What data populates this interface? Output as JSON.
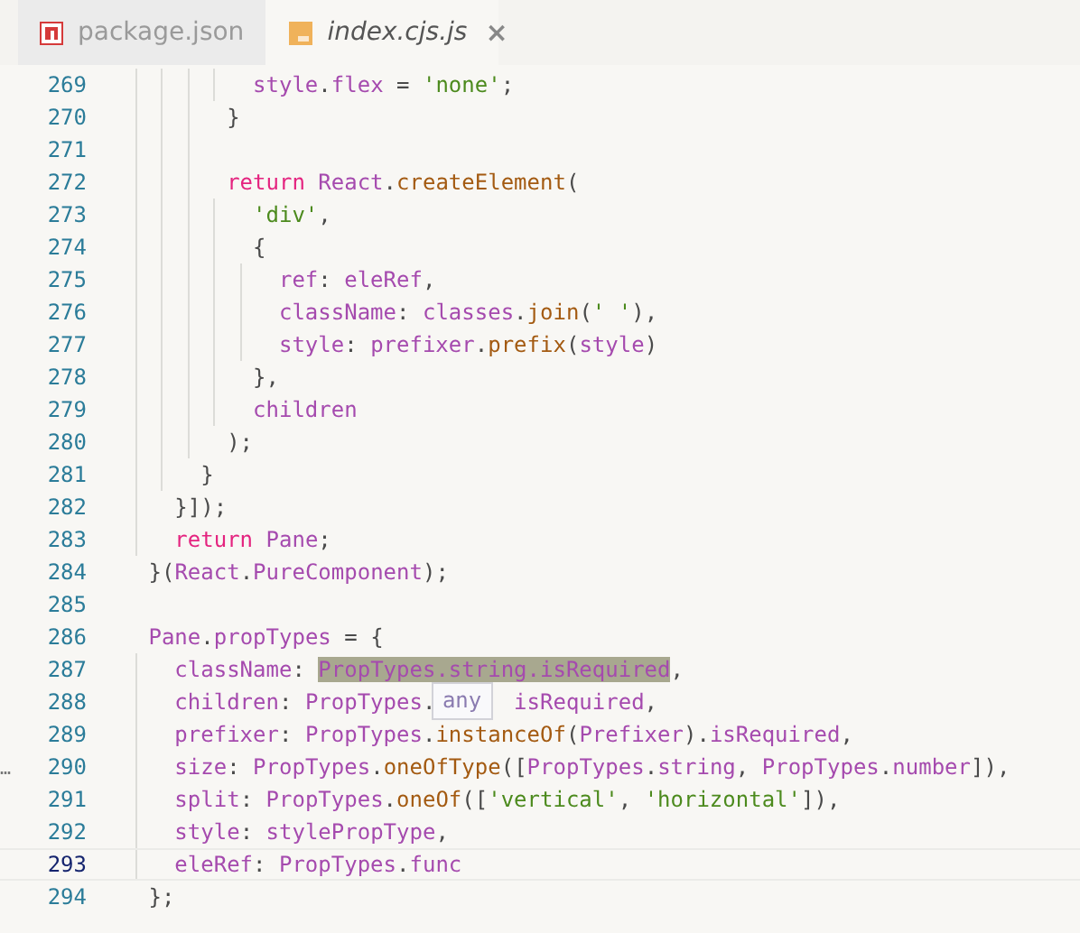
{
  "tabs": [
    {
      "label": "package.json",
      "selected": false
    },
    {
      "label": "index.cjs.js",
      "selected": true,
      "close": "×"
    }
  ],
  "editor": {
    "lines": [
      {
        "number": "269",
        "current": false,
        "tokens": [
          {
            "kind": "prop",
            "text": "        style"
          },
          {
            "kind": "plain",
            "text": "."
          },
          {
            "kind": "prop",
            "text": "flex"
          },
          {
            "kind": "plain",
            "text": " = "
          },
          {
            "kind": "string",
            "text": "'none'"
          },
          {
            "kind": "plain",
            "text": ";"
          }
        ]
      },
      {
        "number": "270",
        "current": false,
        "tokens": [
          {
            "kind": "plain",
            "text": "      }"
          }
        ]
      },
      {
        "number": "271",
        "current": false
      },
      {
        "number": "272",
        "current": false,
        "tokens": [
          {
            "kind": "keyword",
            "text": "      return "
          },
          {
            "kind": "prop",
            "text": "React"
          },
          {
            "kind": "plain",
            "text": "."
          },
          {
            "kind": "func",
            "text": "createElement"
          },
          {
            "kind": "plain",
            "text": "("
          }
        ]
      },
      {
        "number": "273",
        "current": false,
        "tokens": [
          {
            "kind": "string",
            "text": "        'div'"
          },
          {
            "kind": "plain",
            "text": ","
          }
        ]
      },
      {
        "number": "274",
        "current": false,
        "tokens": [
          {
            "kind": "plain",
            "text": "        {"
          }
        ]
      },
      {
        "number": "275",
        "current": false,
        "tokens": [
          {
            "kind": "prop",
            "text": "          ref"
          },
          {
            "kind": "plain",
            "text": ": "
          },
          {
            "kind": "prop",
            "text": "eleRef"
          },
          {
            "kind": "plain",
            "text": ","
          }
        ]
      },
      {
        "number": "276",
        "current": false,
        "tokens": [
          {
            "kind": "prop",
            "text": "          className"
          },
          {
            "kind": "plain",
            "text": ": "
          },
          {
            "kind": "prop",
            "text": "classes"
          },
          {
            "kind": "plain",
            "text": "."
          },
          {
            "kind": "func",
            "text": "join"
          },
          {
            "kind": "plain",
            "text": "("
          },
          {
            "kind": "string",
            "text": "' '"
          },
          {
            "kind": "plain",
            "text": "),"
          }
        ]
      },
      {
        "number": "277",
        "current": false,
        "tokens": [
          {
            "kind": "prop",
            "text": "          style"
          },
          {
            "kind": "plain",
            "text": ": "
          },
          {
            "kind": "prop",
            "text": "prefixer"
          },
          {
            "kind": "plain",
            "text": "."
          },
          {
            "kind": "func",
            "text": "prefix"
          },
          {
            "kind": "plain",
            "text": "("
          },
          {
            "kind": "prop",
            "text": "style"
          },
          {
            "kind": "plain",
            "text": ")"
          }
        ]
      },
      {
        "number": "278",
        "current": false,
        "tokens": [
          {
            "kind": "plain",
            "text": "        },"
          }
        ]
      },
      {
        "number": "279",
        "current": false,
        "tokens": [
          {
            "kind": "prop",
            "text": "        children"
          }
        ]
      },
      {
        "number": "280",
        "current": false,
        "tokens": [
          {
            "kind": "plain",
            "text": "      );"
          }
        ]
      },
      {
        "number": "281",
        "current": false,
        "tokens": [
          {
            "kind": "plain",
            "text": "    }"
          }
        ]
      },
      {
        "number": "282",
        "current": false,
        "tokens": [
          {
            "kind": "plain",
            "text": "  }]);"
          }
        ]
      },
      {
        "number": "283",
        "current": false,
        "tokens": [
          {
            "kind": "keyword",
            "text": "  return "
          },
          {
            "kind": "prop",
            "text": "Pane"
          },
          {
            "kind": "plain",
            "text": ";"
          }
        ]
      },
      {
        "number": "284",
        "current": false,
        "tokens": [
          {
            "kind": "plain",
            "text": "}("
          },
          {
            "kind": "prop",
            "text": "React"
          },
          {
            "kind": "plain",
            "text": "."
          },
          {
            "kind": "prop",
            "text": "PureComponent"
          },
          {
            "kind": "plain",
            "text": ");"
          }
        ]
      },
      {
        "number": "285",
        "current": false
      },
      {
        "number": "286",
        "current": false,
        "tokens": [
          {
            "kind": "prop",
            "text": "Pane"
          },
          {
            "kind": "plain",
            "text": "."
          },
          {
            "kind": "prop",
            "text": "propTypes"
          },
          {
            "kind": "plain",
            "text": " = {"
          }
        ]
      },
      {
        "number": "287",
        "current": false,
        "tokens": [
          {
            "kind": "prop",
            "text": "  className"
          },
          {
            "kind": "plain",
            "text": ": "
          },
          {
            "kind": "prop",
            "text": "PropTypes.string.isRequired",
            "highlighted": true
          },
          {
            "kind": "plain",
            "text": ","
          }
        ]
      },
      {
        "number": "288",
        "current": false,
        "tokens": [
          {
            "kind": "prop",
            "text": "  children"
          },
          {
            "kind": "plain",
            "text": ": "
          },
          {
            "kind": "prop",
            "text": "PropTypes"
          },
          {
            "kind": "plain",
            "text": "."
          },
          {
            "kind": "popup",
            "text": "any"
          },
          {
            "kind": "prop",
            "text": "isRequired"
          },
          {
            "kind": "plain",
            "text": ","
          }
        ]
      },
      {
        "number": "289",
        "current": false,
        "tokens": [
          {
            "kind": "prop",
            "text": "  prefixer"
          },
          {
            "kind": "plain",
            "text": ": "
          },
          {
            "kind": "prop",
            "text": "PropTypes"
          },
          {
            "kind": "plain",
            "text": "."
          },
          {
            "kind": "func",
            "text": "instanceOf"
          },
          {
            "kind": "plain",
            "text": "("
          },
          {
            "kind": "prop",
            "text": "Prefixer"
          },
          {
            "kind": "plain",
            "text": ")."
          },
          {
            "kind": "prop",
            "text": "isRequired"
          },
          {
            "kind": "plain",
            "text": ","
          }
        ]
      },
      {
        "number": "290",
        "current": false,
        "gutter_mark": "…",
        "tokens": [
          {
            "kind": "prop",
            "text": "  size"
          },
          {
            "kind": "plain",
            "text": ": "
          },
          {
            "kind": "prop",
            "text": "PropTypes"
          },
          {
            "kind": "plain",
            "text": "."
          },
          {
            "kind": "func",
            "text": "oneOfType"
          },
          {
            "kind": "plain",
            "text": "(["
          },
          {
            "kind": "prop",
            "text": "PropTypes"
          },
          {
            "kind": "plain",
            "text": "."
          },
          {
            "kind": "prop",
            "text": "string"
          },
          {
            "kind": "plain",
            "text": ", "
          },
          {
            "kind": "prop",
            "text": "PropTypes"
          },
          {
            "kind": "plain",
            "text": "."
          },
          {
            "kind": "prop",
            "text": "number"
          },
          {
            "kind": "plain",
            "text": "]),"
          }
        ]
      },
      {
        "number": "291",
        "current": false,
        "tokens": [
          {
            "kind": "prop",
            "text": "  split"
          },
          {
            "kind": "plain",
            "text": ": "
          },
          {
            "kind": "prop",
            "text": "PropTypes"
          },
          {
            "kind": "plain",
            "text": "."
          },
          {
            "kind": "func",
            "text": "oneOf"
          },
          {
            "kind": "plain",
            "text": "(["
          },
          {
            "kind": "string",
            "text": "'vertical'"
          },
          {
            "kind": "plain",
            "text": ", "
          },
          {
            "kind": "string",
            "text": "'horizontal'"
          },
          {
            "kind": "plain",
            "text": "]),"
          }
        ]
      },
      {
        "number": "292",
        "current": false,
        "tokens": [
          {
            "kind": "prop",
            "text": "  style"
          },
          {
            "kind": "plain",
            "text": ": "
          },
          {
            "kind": "prop",
            "text": "stylePropType"
          },
          {
            "kind": "plain",
            "text": ","
          }
        ]
      },
      {
        "number": "293",
        "current": true,
        "tokens": [
          {
            "kind": "prop",
            "text": "  eleRef"
          },
          {
            "kind": "plain",
            "text": ": "
          },
          {
            "kind": "prop",
            "text": "PropTypes"
          },
          {
            "kind": "plain",
            "text": "."
          },
          {
            "kind": "prop",
            "text": "func"
          }
        ]
      },
      {
        "number": "294",
        "current": false,
        "tokens": [
          {
            "kind": "plain",
            "text": "};"
          }
        ]
      }
    ]
  }
}
